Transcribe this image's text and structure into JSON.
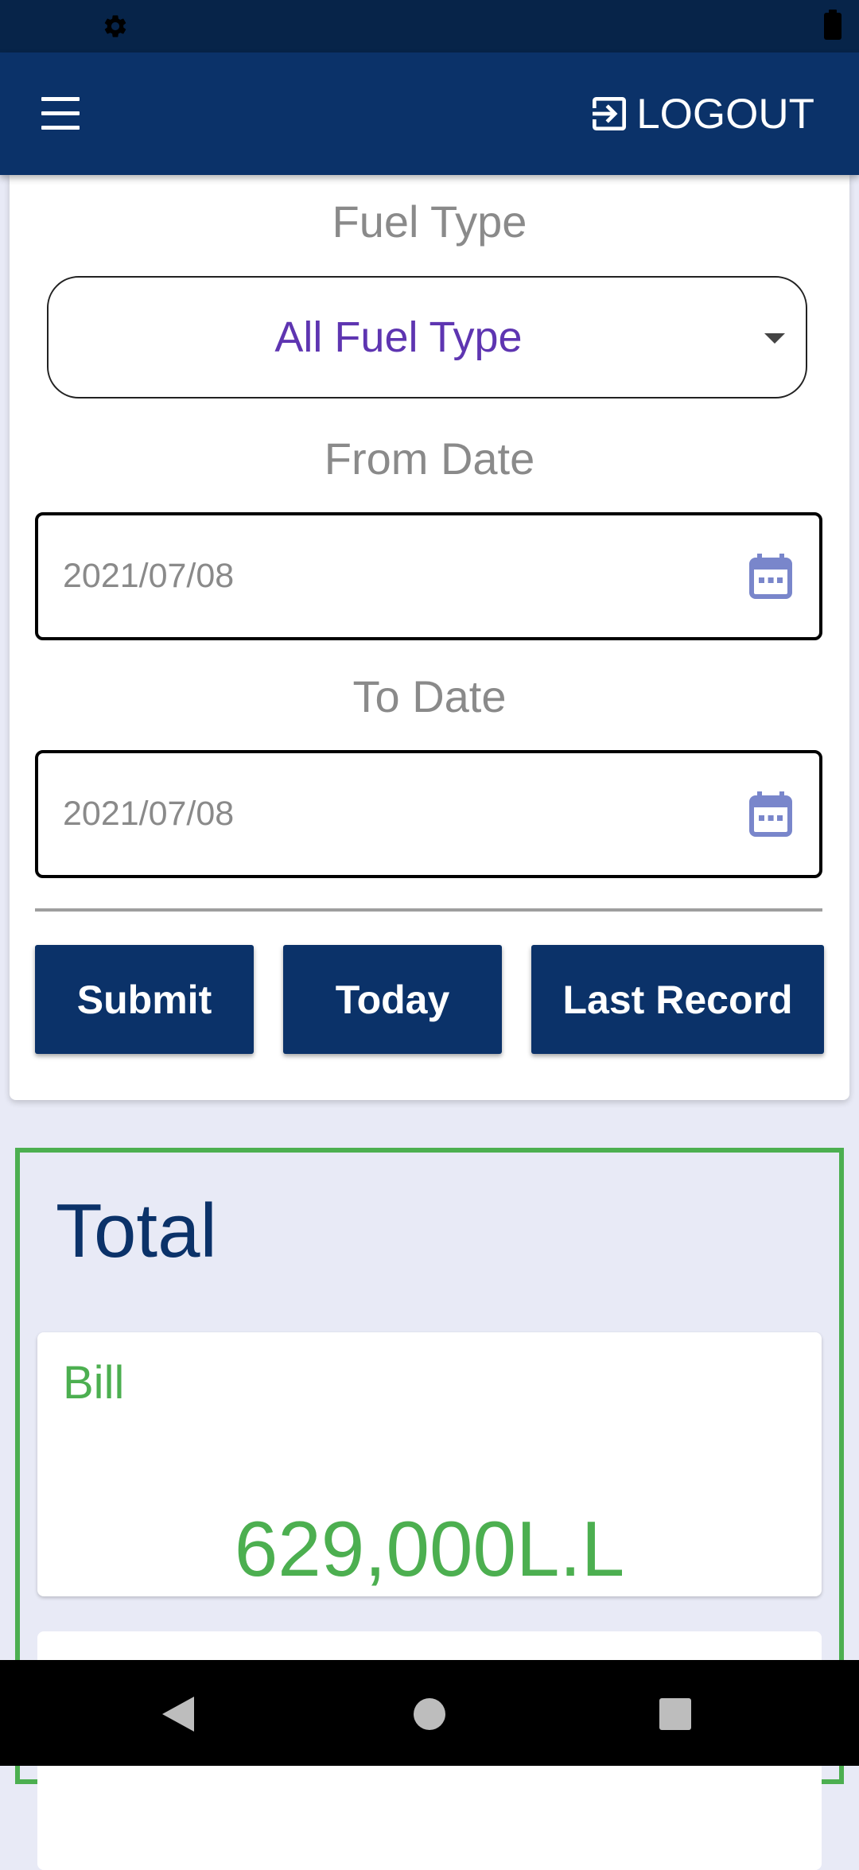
{
  "status_bar": {
    "icons": [
      "gear-icon",
      "battery-icon"
    ]
  },
  "app_bar": {
    "menu_icon": "hamburger-menu-icon",
    "logout_label": "LOGOUT",
    "logout_icon": "logout-icon"
  },
  "form": {
    "fuel_type": {
      "label": "Fuel Type",
      "value": "All Fuel Type"
    },
    "from_date": {
      "label": "From Date",
      "value": "2021/07/08",
      "icon": "calendar-icon"
    },
    "to_date": {
      "label": "To Date",
      "value": "2021/07/08",
      "icon": "calendar-icon"
    },
    "buttons": {
      "submit": "Submit",
      "today": "Today",
      "last_record": "Last Record"
    }
  },
  "total": {
    "title": "Total",
    "bill": {
      "label": "Bill",
      "amount": "629,000L.L"
    }
  },
  "colors": {
    "app_bar": "#0b3269",
    "status_bar": "#072449",
    "accent_green": "#4caf50",
    "dropdown_text": "#5e35b1",
    "calendar_icon": "#7986cb",
    "background": "#e8eaf6"
  },
  "nav_bar": {
    "icons": [
      "back-icon",
      "home-icon",
      "recents-icon"
    ]
  }
}
